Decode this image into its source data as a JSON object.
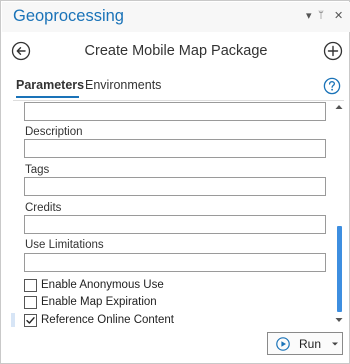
{
  "pane": {
    "title": "Geoprocessing",
    "controls": {
      "dropdown": "▾",
      "pin": "ᛘ",
      "close": "✕"
    }
  },
  "tool": {
    "title": "Create Mobile Map Package",
    "back_icon": "back-arrow-circle-icon",
    "add_icon": "add-circle-icon"
  },
  "tabs": [
    {
      "label": "Parameters",
      "active": true
    },
    {
      "label": "Environments",
      "active": false
    }
  ],
  "help_icon": "help-circle-icon",
  "fields": [
    {
      "label": "",
      "value": ""
    },
    {
      "label": "Description",
      "value": ""
    },
    {
      "label": "Tags",
      "value": ""
    },
    {
      "label": "Credits",
      "value": ""
    },
    {
      "label": "Use Limitations",
      "value": ""
    }
  ],
  "checkboxes": [
    {
      "label": "Enable Anonymous Use",
      "checked": false
    },
    {
      "label": "Enable Map Expiration",
      "checked": false
    },
    {
      "label": "Reference Online Content",
      "checked": true
    }
  ],
  "run_button": {
    "label": "Run",
    "icon": "play-circle-icon"
  },
  "colors": {
    "accent": "#1a73b8",
    "scroll_thumb": "#3d8ee0",
    "header_bg": "#f7f7f7"
  }
}
